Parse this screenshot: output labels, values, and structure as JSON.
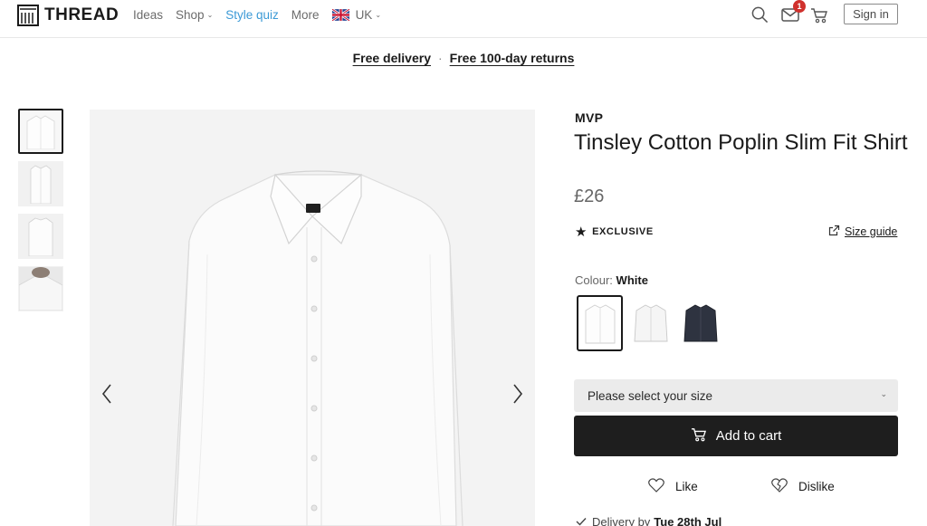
{
  "header": {
    "logo_text": "THREAD",
    "nav": [
      {
        "label": "Ideas"
      },
      {
        "label": "Shop"
      },
      {
        "label": "Style quiz"
      },
      {
        "label": "More"
      },
      {
        "label": "UK"
      }
    ],
    "notification_count": "1",
    "signin_label": "Sign in"
  },
  "promo": {
    "delivery": "Free delivery",
    "separator": "·",
    "returns": "Free 100-day returns"
  },
  "product": {
    "brand": "MVP",
    "title": "Tinsley Cotton Poplin Slim Fit Shirt",
    "price": "£26",
    "exclusive": "EXCLUSIVE",
    "size_guide": "Size guide",
    "colour_label": "Colour:",
    "colour_value": "White",
    "size_placeholder": "Please select your size",
    "add_to_cart": "Add to cart",
    "like": "Like",
    "dislike": "Dislike",
    "delivery_label": "Delivery by",
    "delivery_date": "Tue 28th Jul"
  },
  "colors": {
    "accent_link": "#3c9ad6",
    "badge": "#d0312d",
    "cart_button": "#1e1e1e",
    "select_bg": "#ebebeb"
  },
  "icons": [
    "thread-logo-icon",
    "chevron-down-icon",
    "uk-flag-icon",
    "search-icon",
    "mail-icon",
    "cart-icon",
    "star-icon",
    "external-link-icon",
    "chevron-left-icon",
    "chevron-right-icon",
    "heart-icon",
    "broken-heart-icon",
    "check-icon"
  ]
}
